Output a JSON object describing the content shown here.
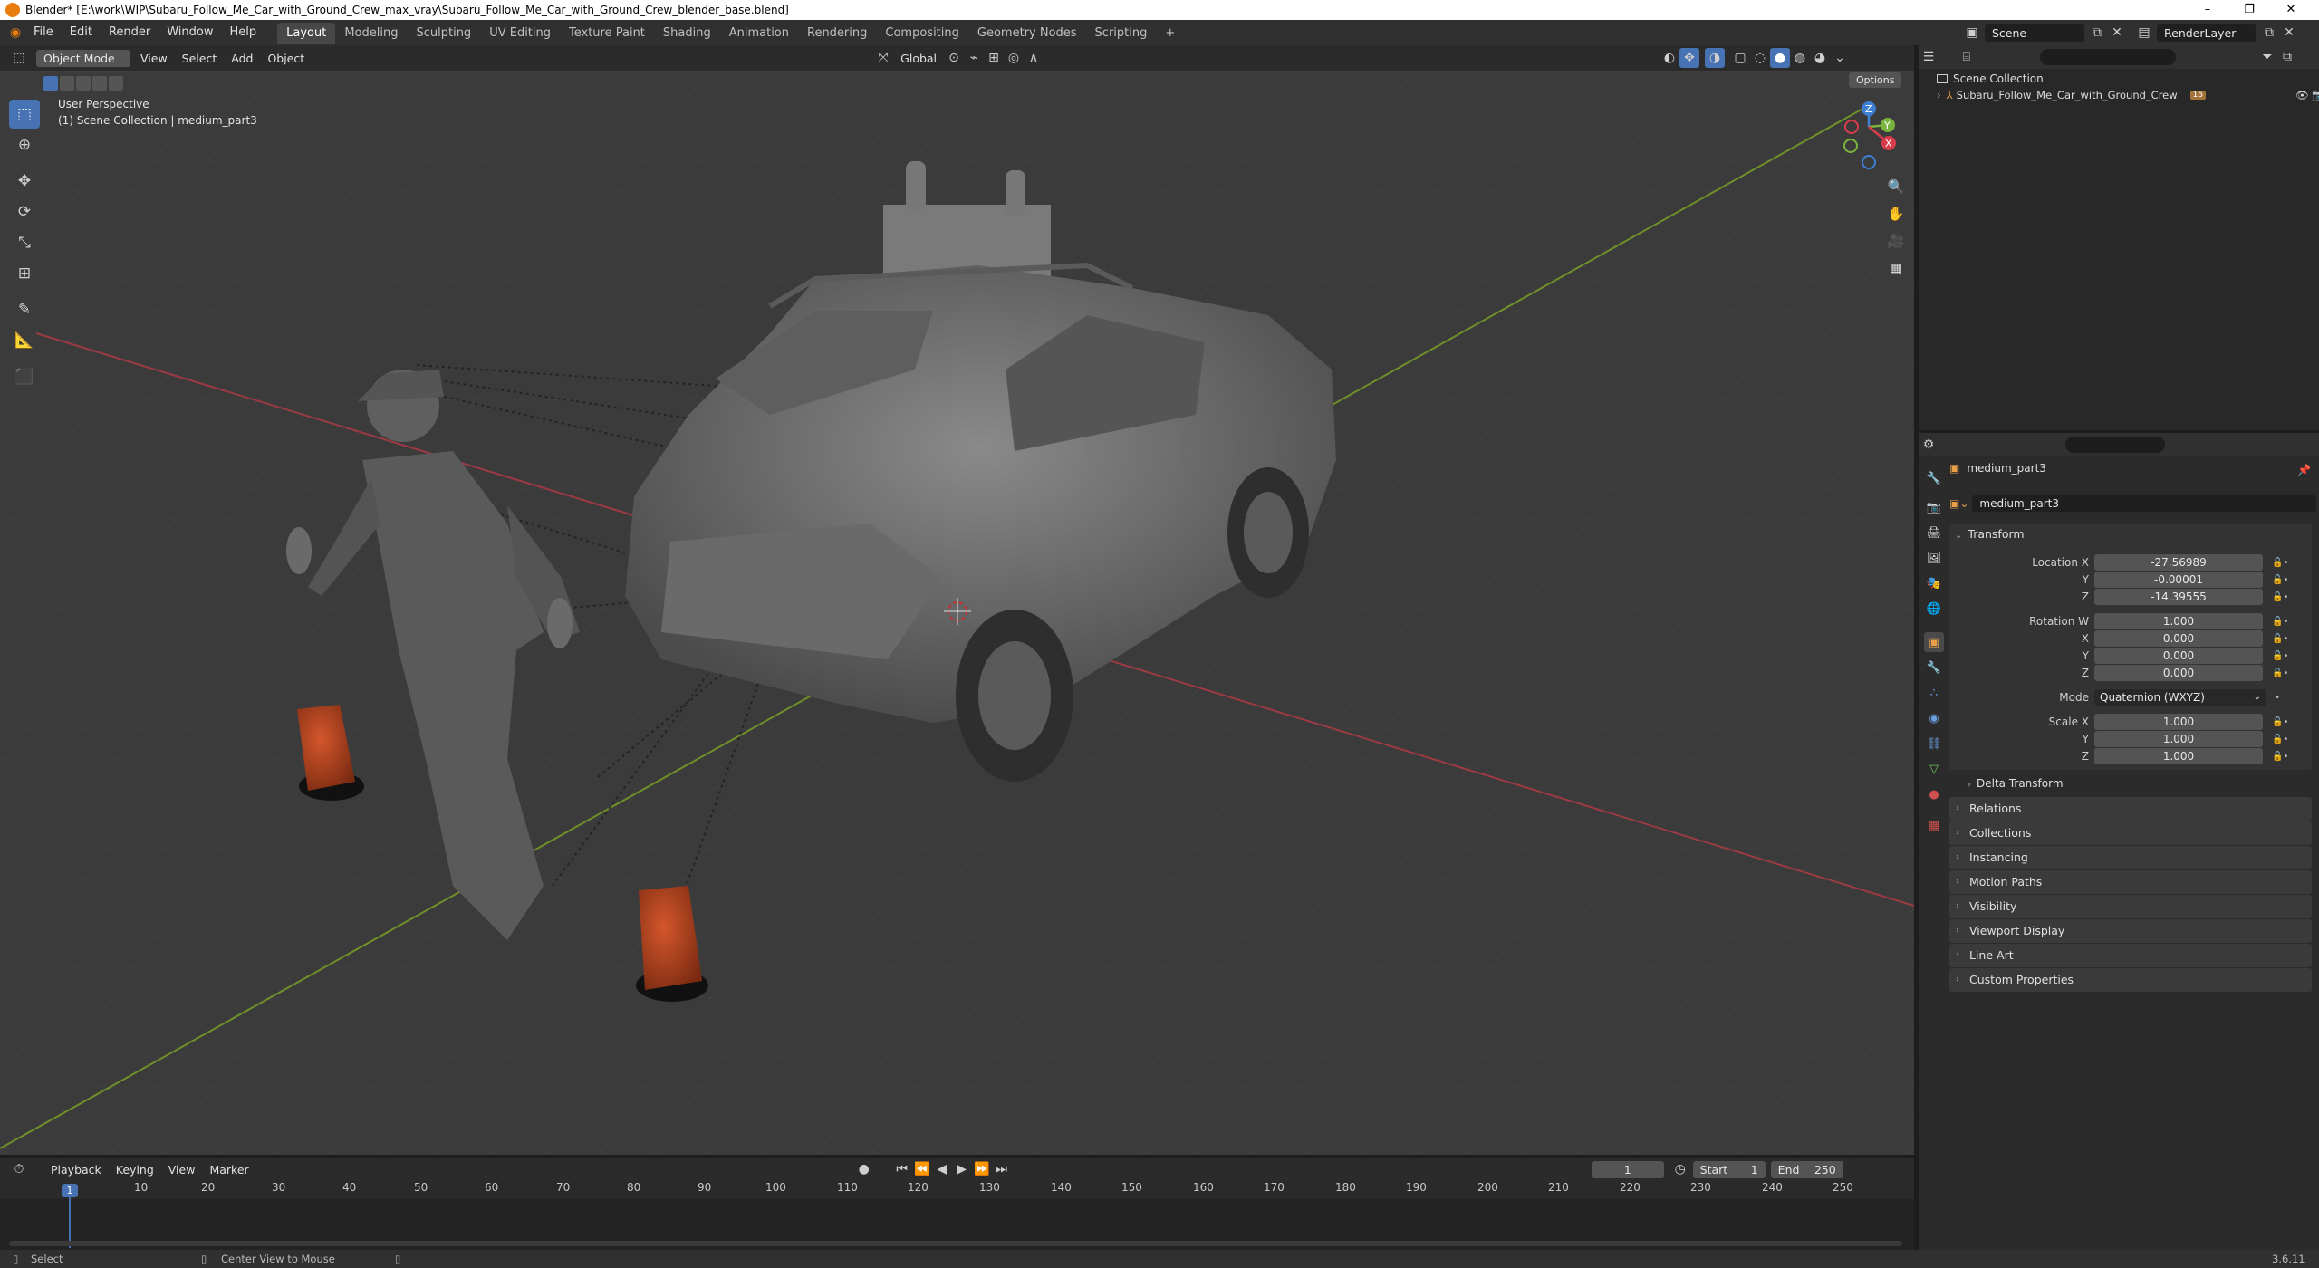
{
  "window": {
    "title": "Blender* [E:\\work\\WIP\\Subaru_Follow_Me_Car_with_Ground_Crew_max_vray\\Subaru_Follow_Me_Car_with_Ground_Crew_blender_base.blend]",
    "minimize": "–",
    "maximize": "❐",
    "close": "✕"
  },
  "menus": [
    "File",
    "Edit",
    "Render",
    "Window",
    "Help"
  ],
  "workspaces": [
    "Layout",
    "Modeling",
    "Sculpting",
    "UV Editing",
    "Texture Paint",
    "Shading",
    "Animation",
    "Rendering",
    "Compositing",
    "Geometry Nodes",
    "Scripting"
  ],
  "active_workspace": "Layout",
  "add_workspace": "+",
  "scene": {
    "name": "Scene",
    "render_layer": "RenderLayer"
  },
  "viewport_header": {
    "mode": "Object Mode",
    "menus": [
      "View",
      "Select",
      "Add",
      "Object"
    ],
    "orientation": "Global",
    "options": "Options"
  },
  "viewport": {
    "perspective": "User Perspective",
    "collection_info": "(1) Scene Collection | medium_part3"
  },
  "gizmo": {
    "x": "X",
    "y": "Y",
    "z": "Z"
  },
  "outliner": {
    "root": "Scene Collection",
    "items": [
      {
        "name": "Subaru_Follow_Me_Car_with_Ground_Crew",
        "badge": "15"
      }
    ]
  },
  "properties": {
    "object_name": "medium_part3",
    "data_name": "medium_part3",
    "transform_label": "Transform",
    "location": {
      "label": "Location X",
      "x": "-27.56989",
      "y": "-0.00001",
      "z": "-14.39555"
    },
    "rotation": {
      "label": "Rotation W",
      "w": "1.000",
      "x": "0.000",
      "y": "0.000",
      "z": "0.000"
    },
    "mode": {
      "label": "Mode",
      "value": "Quaternion (WXYZ)"
    },
    "scale": {
      "label": "Scale X",
      "x": "1.000",
      "y": "1.000",
      "z": "1.000"
    },
    "axis_labels": {
      "x": "X",
      "y": "Y",
      "z": "Z"
    },
    "delta": "Delta Transform",
    "panels": [
      "Relations",
      "Collections",
      "Instancing",
      "Motion Paths",
      "Visibility",
      "Viewport Display",
      "Line Art",
      "Custom Properties"
    ]
  },
  "timeline": {
    "menus": [
      "Playback",
      "Keying",
      "View",
      "Marker"
    ],
    "current_frame": "1",
    "start_label": "Start",
    "start": "1",
    "end_label": "End",
    "end": "250",
    "ruler": [
      "10",
      "20",
      "30",
      "40",
      "50",
      "60",
      "70",
      "80",
      "90",
      "100",
      "110",
      "120",
      "130",
      "140",
      "150",
      "160",
      "170",
      "180",
      "190",
      "200",
      "210",
      "220",
      "230",
      "240",
      "250"
    ]
  },
  "statusbar": {
    "select": "Select",
    "center": "Center View to Mouse",
    "version": "3.6.11"
  },
  "colors": {
    "accent": "#4772b3",
    "x_axis": "#9c3a44",
    "y_axis": "#6f8f2a",
    "cone": "#b3421f"
  }
}
